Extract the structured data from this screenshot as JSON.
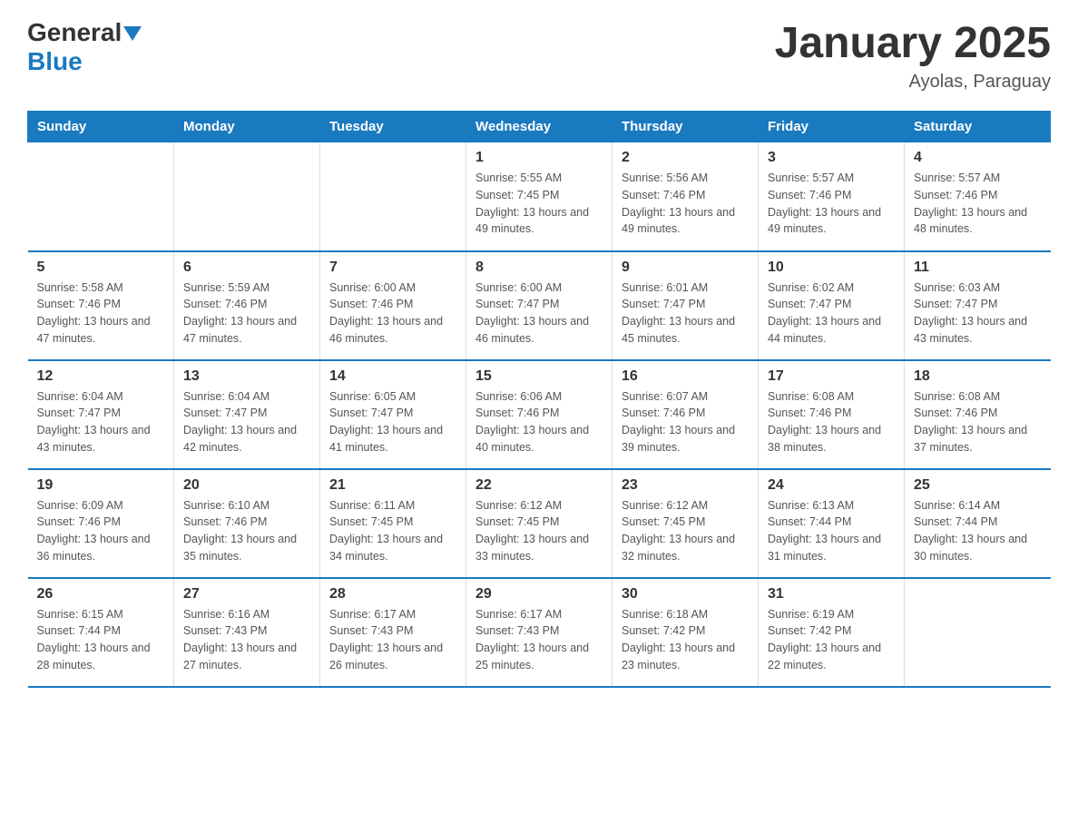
{
  "logo": {
    "text_general": "General",
    "text_blue": "Blue"
  },
  "title": "January 2025",
  "location": "Ayolas, Paraguay",
  "days_of_week": [
    "Sunday",
    "Monday",
    "Tuesday",
    "Wednesday",
    "Thursday",
    "Friday",
    "Saturday"
  ],
  "weeks": [
    [
      {
        "day": "",
        "info": ""
      },
      {
        "day": "",
        "info": ""
      },
      {
        "day": "",
        "info": ""
      },
      {
        "day": "1",
        "info": "Sunrise: 5:55 AM\nSunset: 7:45 PM\nDaylight: 13 hours\nand 49 minutes."
      },
      {
        "day": "2",
        "info": "Sunrise: 5:56 AM\nSunset: 7:46 PM\nDaylight: 13 hours\nand 49 minutes."
      },
      {
        "day": "3",
        "info": "Sunrise: 5:57 AM\nSunset: 7:46 PM\nDaylight: 13 hours\nand 49 minutes."
      },
      {
        "day": "4",
        "info": "Sunrise: 5:57 AM\nSunset: 7:46 PM\nDaylight: 13 hours\nand 48 minutes."
      }
    ],
    [
      {
        "day": "5",
        "info": "Sunrise: 5:58 AM\nSunset: 7:46 PM\nDaylight: 13 hours\nand 47 minutes."
      },
      {
        "day": "6",
        "info": "Sunrise: 5:59 AM\nSunset: 7:46 PM\nDaylight: 13 hours\nand 47 minutes."
      },
      {
        "day": "7",
        "info": "Sunrise: 6:00 AM\nSunset: 7:46 PM\nDaylight: 13 hours\nand 46 minutes."
      },
      {
        "day": "8",
        "info": "Sunrise: 6:00 AM\nSunset: 7:47 PM\nDaylight: 13 hours\nand 46 minutes."
      },
      {
        "day": "9",
        "info": "Sunrise: 6:01 AM\nSunset: 7:47 PM\nDaylight: 13 hours\nand 45 minutes."
      },
      {
        "day": "10",
        "info": "Sunrise: 6:02 AM\nSunset: 7:47 PM\nDaylight: 13 hours\nand 44 minutes."
      },
      {
        "day": "11",
        "info": "Sunrise: 6:03 AM\nSunset: 7:47 PM\nDaylight: 13 hours\nand 43 minutes."
      }
    ],
    [
      {
        "day": "12",
        "info": "Sunrise: 6:04 AM\nSunset: 7:47 PM\nDaylight: 13 hours\nand 43 minutes."
      },
      {
        "day": "13",
        "info": "Sunrise: 6:04 AM\nSunset: 7:47 PM\nDaylight: 13 hours\nand 42 minutes."
      },
      {
        "day": "14",
        "info": "Sunrise: 6:05 AM\nSunset: 7:47 PM\nDaylight: 13 hours\nand 41 minutes."
      },
      {
        "day": "15",
        "info": "Sunrise: 6:06 AM\nSunset: 7:46 PM\nDaylight: 13 hours\nand 40 minutes."
      },
      {
        "day": "16",
        "info": "Sunrise: 6:07 AM\nSunset: 7:46 PM\nDaylight: 13 hours\nand 39 minutes."
      },
      {
        "day": "17",
        "info": "Sunrise: 6:08 AM\nSunset: 7:46 PM\nDaylight: 13 hours\nand 38 minutes."
      },
      {
        "day": "18",
        "info": "Sunrise: 6:08 AM\nSunset: 7:46 PM\nDaylight: 13 hours\nand 37 minutes."
      }
    ],
    [
      {
        "day": "19",
        "info": "Sunrise: 6:09 AM\nSunset: 7:46 PM\nDaylight: 13 hours\nand 36 minutes."
      },
      {
        "day": "20",
        "info": "Sunrise: 6:10 AM\nSunset: 7:46 PM\nDaylight: 13 hours\nand 35 minutes."
      },
      {
        "day": "21",
        "info": "Sunrise: 6:11 AM\nSunset: 7:45 PM\nDaylight: 13 hours\nand 34 minutes."
      },
      {
        "day": "22",
        "info": "Sunrise: 6:12 AM\nSunset: 7:45 PM\nDaylight: 13 hours\nand 33 minutes."
      },
      {
        "day": "23",
        "info": "Sunrise: 6:12 AM\nSunset: 7:45 PM\nDaylight: 13 hours\nand 32 minutes."
      },
      {
        "day": "24",
        "info": "Sunrise: 6:13 AM\nSunset: 7:44 PM\nDaylight: 13 hours\nand 31 minutes."
      },
      {
        "day": "25",
        "info": "Sunrise: 6:14 AM\nSunset: 7:44 PM\nDaylight: 13 hours\nand 30 minutes."
      }
    ],
    [
      {
        "day": "26",
        "info": "Sunrise: 6:15 AM\nSunset: 7:44 PM\nDaylight: 13 hours\nand 28 minutes."
      },
      {
        "day": "27",
        "info": "Sunrise: 6:16 AM\nSunset: 7:43 PM\nDaylight: 13 hours\nand 27 minutes."
      },
      {
        "day": "28",
        "info": "Sunrise: 6:17 AM\nSunset: 7:43 PM\nDaylight: 13 hours\nand 26 minutes."
      },
      {
        "day": "29",
        "info": "Sunrise: 6:17 AM\nSunset: 7:43 PM\nDaylight: 13 hours\nand 25 minutes."
      },
      {
        "day": "30",
        "info": "Sunrise: 6:18 AM\nSunset: 7:42 PM\nDaylight: 13 hours\nand 23 minutes."
      },
      {
        "day": "31",
        "info": "Sunrise: 6:19 AM\nSunset: 7:42 PM\nDaylight: 13 hours\nand 22 minutes."
      },
      {
        "day": "",
        "info": ""
      }
    ]
  ]
}
